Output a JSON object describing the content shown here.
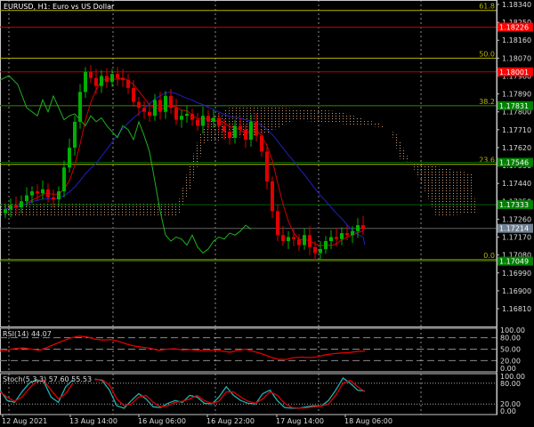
{
  "title": "EURUSD, H1:  Euro vs US Dollar",
  "colors": {
    "bull": "#00b000",
    "bear": "#e00000",
    "grid": "#c8c8c8",
    "axis": "#c8c8c8",
    "fibo": "#b5b500",
    "ma_fast": "#d00000",
    "ma_slow": "#2020c0",
    "chikou": "#20b020",
    "cloud": "#d09a70",
    "rsi": "#e00000",
    "stoch_main": "#20b0b0",
    "stoch_signal": "#e00000"
  },
  "price_axis": [
    "1.18340",
    "1.18250",
    "1.18160",
    "1.18070",
    "1.17980",
    "1.17890",
    "1.17800",
    "1.17710",
    "1.17620",
    "1.17530",
    "1.17440",
    "1.17350",
    "1.17260",
    "1.17170",
    "1.17080",
    "1.16990",
    "1.16900",
    "1.16810"
  ],
  "fibo_levels": [
    {
      "label": "61.8",
      "price": 1.1831
    },
    {
      "label": "50.0",
      "price": 1.1807
    },
    {
      "label": "38.2",
      "price": 1.17831
    },
    {
      "label": "23.6",
      "price": 1.17536
    },
    {
      "label": "0.0",
      "price": 1.17056
    }
  ],
  "price_lines": [
    {
      "label": "1.18226",
      "price": 1.18226,
      "color": "#ff0000",
      "line": "#c00000"
    },
    {
      "label": "1.18001",
      "price": 1.18001,
      "color": "#ff0000",
      "line": "#c00000"
    },
    {
      "label": "1.17831",
      "price": 1.17831,
      "color": "#008000",
      "line": "#006000"
    },
    {
      "label": "1.17546",
      "price": 1.17546,
      "color": "#008000",
      "line": "#006000"
    },
    {
      "label": "1.17333",
      "price": 1.17333,
      "color": "#008000",
      "line": "#006000"
    },
    {
      "label": "1.17214",
      "price": 1.17214,
      "color": "#708090",
      "line": "#606060"
    },
    {
      "label": "1.17049",
      "price": 1.17049,
      "color": "#008000",
      "line": "#006000"
    }
  ],
  "time_axis": [
    "12 Aug 2021",
    "13 Aug 14:00",
    "16 Aug 06:00",
    "16 Aug 22:00",
    "17 Aug 14:00",
    "18 Aug 06:00"
  ],
  "rsi": {
    "label": "RSI(14) 44.07",
    "levels": [
      "100.00",
      "80.00",
      "50.00",
      "20.00",
      "0.00"
    ],
    "values": [
      45,
      48,
      52,
      53,
      50,
      47,
      55,
      64,
      72,
      80,
      84,
      82,
      76,
      74,
      75,
      70,
      63,
      58,
      55,
      52,
      47,
      50,
      51,
      48,
      49,
      47,
      46,
      48,
      45,
      42,
      47,
      50,
      44,
      38,
      30,
      24,
      23,
      28,
      29,
      28,
      30,
      35,
      38,
      40,
      41,
      44,
      45
    ]
  },
  "stoch": {
    "label": "Stoch(5,3,3) 57.60 55.53",
    "levels": [
      "100.00",
      "80.00",
      "20.00",
      "0.00"
    ],
    "main": [
      60,
      30,
      25,
      55,
      80,
      90,
      85,
      40,
      25,
      70,
      90,
      null,
      null,
      92,
      88,
      60,
      15,
      8,
      30,
      50,
      35,
      12,
      10,
      22,
      30,
      25,
      45,
      40,
      22,
      20,
      40,
      70,
      45,
      30,
      22,
      20,
      50,
      60,
      30,
      10,
      8,
      8,
      12,
      15,
      14,
      30,
      60,
      95,
      80,
      60,
      57.6
    ],
    "signal": [
      55,
      40,
      28,
      40,
      65,
      85,
      88,
      60,
      35,
      50,
      80,
      null,
      null,
      90,
      90,
      75,
      35,
      15,
      20,
      40,
      45,
      25,
      12,
      15,
      25,
      28,
      35,
      45,
      30,
      22,
      28,
      55,
      55,
      40,
      28,
      22,
      35,
      55,
      45,
      22,
      10,
      8,
      9,
      12,
      14,
      20,
      45,
      80,
      88,
      70,
      55.5
    ]
  },
  "chart_data": {
    "type": "candlestick",
    "title": "EURUSD, H1:  Euro vs US Dollar",
    "ylim": [
      1.1681,
      1.1836
    ],
    "closes": [
      1.1731,
      1.1733,
      1.1732,
      1.1735,
      1.1738,
      1.174,
      1.1739,
      1.1741,
      1.1737,
      1.1736,
      1.174,
      1.1752,
      1.1762,
      1.1775,
      1.179,
      1.18,
      1.1797,
      1.1793,
      1.1798,
      1.1795,
      1.1799,
      1.1797,
      1.1796,
      1.1792,
      1.1785,
      1.1782,
      1.178,
      1.1778,
      1.1786,
      1.178,
      1.1788,
      1.1782,
      1.1776,
      1.1778,
      1.1779,
      1.1776,
      1.1773,
      1.1778,
      1.1775,
      1.1777,
      1.1773,
      1.177,
      1.1767,
      1.1773,
      1.1771,
      1.1766,
      1.1775,
      1.1768,
      1.176,
      1.1745,
      1.173,
      1.1718,
      1.1715,
      1.1717,
      1.1716,
      1.1713,
      1.1718,
      1.1712,
      1.1709,
      1.1711,
      1.1715,
      1.1717,
      1.1716,
      1.1719,
      1.1718,
      1.172,
      1.1723,
      1.1721
    ],
    "last_price": "1.17214"
  }
}
